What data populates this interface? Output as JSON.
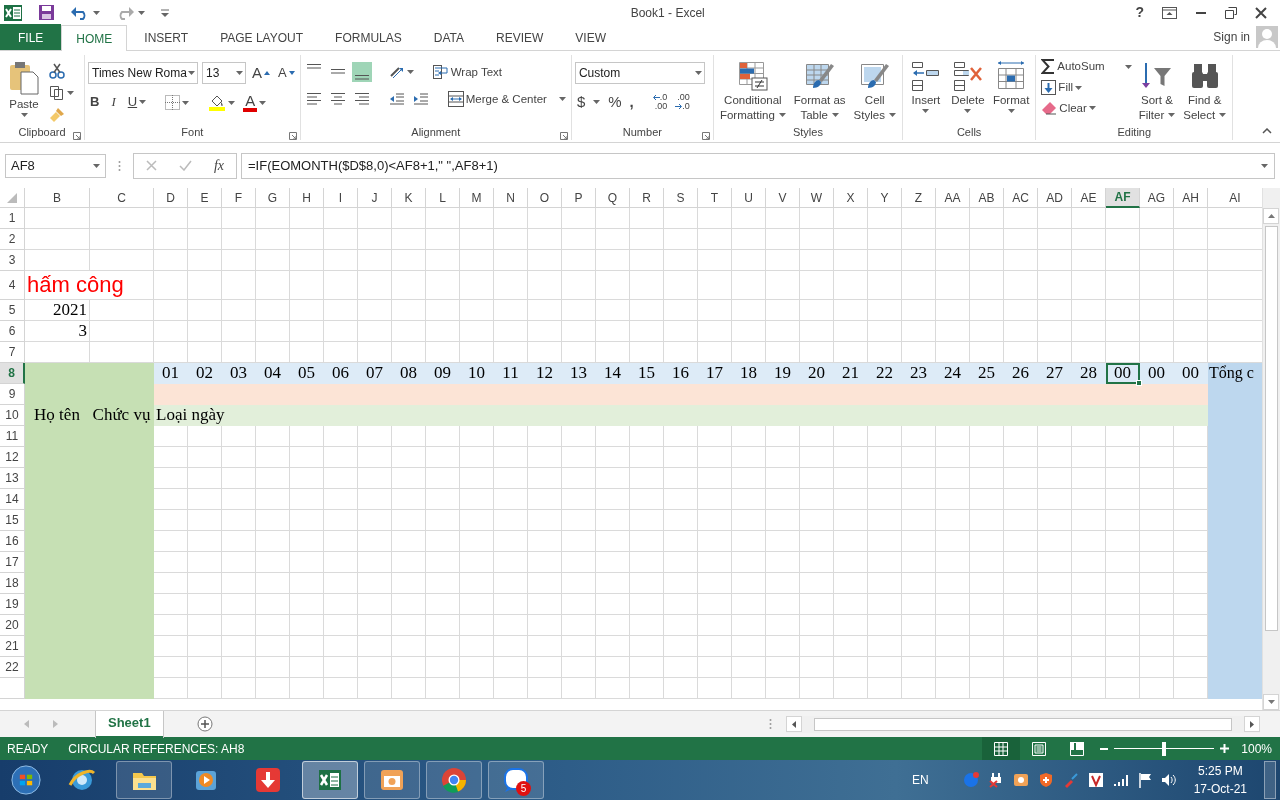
{
  "title_bar": {
    "title": "Book1 - Excel",
    "help": "?"
  },
  "tabs": [
    {
      "label": "FILE",
      "kind": "file",
      "selected": false
    },
    {
      "label": "HOME",
      "kind": "tab",
      "selected": true
    },
    {
      "label": "INSERT",
      "kind": "tab",
      "selected": false
    },
    {
      "label": "PAGE LAYOUT",
      "kind": "tab",
      "selected": false
    },
    {
      "label": "FORMULAS",
      "kind": "tab",
      "selected": false
    },
    {
      "label": "DATA",
      "kind": "tab",
      "selected": false
    },
    {
      "label": "REVIEW",
      "kind": "tab",
      "selected": false
    },
    {
      "label": "VIEW",
      "kind": "tab",
      "selected": false
    }
  ],
  "account": {
    "label": "Sign in"
  },
  "ribbon": {
    "clipboard": {
      "title": "Clipboard",
      "paste": "Paste"
    },
    "font": {
      "title": "Font",
      "font_name": "Times New Roma",
      "font_size": "13",
      "grow": "A",
      "shrink": "A",
      "bold": "B",
      "italic": "I",
      "underline": "U",
      "font_color": "A"
    },
    "alignment": {
      "title": "Alignment",
      "bottom_align_on": true,
      "wrap_text": "Wrap Text",
      "merge_center": "Merge & Center"
    },
    "number": {
      "title": "Number",
      "format": "Custom",
      "currency": "$",
      "percent": "%",
      "comma": ",",
      "increase_decimal": {
        "top": ".0",
        "bottom": ".00"
      },
      "decrease_decimal": {
        "top": ".00",
        "bottom": ".0"
      }
    },
    "styles": {
      "title": "Styles",
      "buttons": [
        {
          "line1": "Conditional",
          "line2": "Formatting"
        },
        {
          "line1": "Format as",
          "line2": "Table"
        },
        {
          "line1": "Cell",
          "line2": "Styles"
        }
      ]
    },
    "cells": {
      "title": "Cells",
      "buttons": [
        "Insert",
        "Delete",
        "Format"
      ]
    },
    "editing": {
      "title": "Editing",
      "autosum": "AutoSum",
      "fill": "Fill",
      "clear": "Clear",
      "sort": {
        "line1": "Sort &",
        "line2": "Filter"
      },
      "find": {
        "line1": "Find &",
        "line2": "Select"
      }
    }
  },
  "formula_bar": {
    "name_box": "AF8",
    "fx": "fx",
    "formula": "=IF(EOMONTH($D$8,0)<AF8+1,\" \",AF8+1)"
  },
  "sheet": {
    "columns": [
      {
        "label": "B",
        "selected": false
      },
      {
        "label": "C",
        "selected": false
      },
      {
        "label": "D",
        "selected": false
      },
      {
        "label": "E",
        "selected": false
      },
      {
        "label": "F",
        "selected": false
      },
      {
        "label": "G",
        "selected": false
      },
      {
        "label": "H",
        "selected": false
      },
      {
        "label": "I",
        "selected": false
      },
      {
        "label": "J",
        "selected": false
      },
      {
        "label": "K",
        "selected": false
      },
      {
        "label": "L",
        "selected": false
      },
      {
        "label": "M",
        "selected": false
      },
      {
        "label": "N",
        "selected": false
      },
      {
        "label": "O",
        "selected": false
      },
      {
        "label": "P",
        "selected": false
      },
      {
        "label": "Q",
        "selected": false
      },
      {
        "label": "R",
        "selected": false
      },
      {
        "label": "S",
        "selected": false
      },
      {
        "label": "T",
        "selected": false
      },
      {
        "label": "U",
        "selected": false
      },
      {
        "label": "V",
        "selected": false
      },
      {
        "label": "W",
        "selected": false
      },
      {
        "label": "X",
        "selected": false
      },
      {
        "label": "Y",
        "selected": false
      },
      {
        "label": "Z",
        "selected": false
      },
      {
        "label": "AA",
        "selected": false
      },
      {
        "label": "AB",
        "selected": false
      },
      {
        "label": "AC",
        "selected": false
      },
      {
        "label": "AD",
        "selected": false
      },
      {
        "label": "AE",
        "selected": false
      },
      {
        "label": "AF",
        "selected": true
      },
      {
        "label": "AG",
        "selected": false
      },
      {
        "label": "AH",
        "selected": false
      },
      {
        "label": "AI",
        "selected": false
      }
    ],
    "rows": [
      {
        "label": "1",
        "selected": false
      },
      {
        "label": "2",
        "selected": false
      },
      {
        "label": "3",
        "selected": false
      },
      {
        "label": "4",
        "selected": false
      },
      {
        "label": "5",
        "selected": false
      },
      {
        "label": "6",
        "selected": false
      },
      {
        "label": "7",
        "selected": false
      },
      {
        "label": "8",
        "selected": true
      },
      {
        "label": "9",
        "selected": false
      },
      {
        "label": "10",
        "selected": false
      },
      {
        "label": "11",
        "selected": false
      },
      {
        "label": "12",
        "selected": false
      },
      {
        "label": "13",
        "selected": false
      },
      {
        "label": "14",
        "selected": false
      },
      {
        "label": "15",
        "selected": false
      },
      {
        "label": "16",
        "selected": false
      },
      {
        "label": "17",
        "selected": false
      },
      {
        "label": "18",
        "selected": false
      },
      {
        "label": "19",
        "selected": false
      },
      {
        "label": "20",
        "selected": false
      },
      {
        "label": "21",
        "selected": false
      },
      {
        "label": "22",
        "selected": false
      }
    ],
    "title": "hấm công",
    "year": "2021",
    "month": "3",
    "header": {
      "name": "Họ tên",
      "position": "Chức vụ",
      "day_type": "Loại ngày",
      "total": "Tổng c",
      "days": [
        {
          "text": "01",
          "selected": false
        },
        {
          "text": "02",
          "selected": false
        },
        {
          "text": "03",
          "selected": false
        },
        {
          "text": "04",
          "selected": false
        },
        {
          "text": "05",
          "selected": false
        },
        {
          "text": "06",
          "selected": false
        },
        {
          "text": "07",
          "selected": false
        },
        {
          "text": "08",
          "selected": false
        },
        {
          "text": "09",
          "selected": false
        },
        {
          "text": "10",
          "selected": false
        },
        {
          "text": "11",
          "selected": false
        },
        {
          "text": "12",
          "selected": false
        },
        {
          "text": "13",
          "selected": false
        },
        {
          "text": "14",
          "selected": false
        },
        {
          "text": "15",
          "selected": false
        },
        {
          "text": "16",
          "selected": false
        },
        {
          "text": "17",
          "selected": false
        },
        {
          "text": "18",
          "selected": false
        },
        {
          "text": "19",
          "selected": false
        },
        {
          "text": "20",
          "selected": false
        },
        {
          "text": "21",
          "selected": false
        },
        {
          "text": "22",
          "selected": false
        },
        {
          "text": "23",
          "selected": false
        },
        {
          "text": "24",
          "selected": false
        },
        {
          "text": "25",
          "selected": false
        },
        {
          "text": "26",
          "selected": false
        },
        {
          "text": "27",
          "selected": false
        },
        {
          "text": "28",
          "selected": false
        },
        {
          "text": "00",
          "selected": true
        },
        {
          "text": "00",
          "selected": false
        },
        {
          "text": "00",
          "selected": false
        }
      ]
    }
  },
  "sheet_tabs": [
    {
      "label": "Sheet1",
      "selected": true
    }
  ],
  "status_bar": {
    "mode": "READY",
    "message": "CIRCULAR REFERENCES: AH8",
    "views": [
      {
        "kind": "normal",
        "selected": true
      },
      {
        "kind": "page_layout",
        "selected": false
      },
      {
        "kind": "page_break",
        "selected": false
      }
    ],
    "zoom": {
      "level": 0.5,
      "reading": "100%"
    }
  },
  "taskbar": {
    "apps": [
      {
        "kind": "browser",
        "running": false,
        "active": false
      },
      {
        "kind": "folder",
        "running": true,
        "active": false
      },
      {
        "kind": "player",
        "running": false,
        "active": false
      },
      {
        "kind": "download",
        "running": false,
        "active": false
      },
      {
        "kind": "sheet",
        "running": true,
        "active": true
      },
      {
        "kind": "camera",
        "running": true,
        "active": false
      },
      {
        "kind": "chrome",
        "running": true,
        "active": false
      },
      {
        "kind": "chat",
        "running": true,
        "active": false,
        "badge": "5"
      }
    ],
    "language": "EN",
    "time": "5:25 PM",
    "date": "17-Oct-21"
  }
}
